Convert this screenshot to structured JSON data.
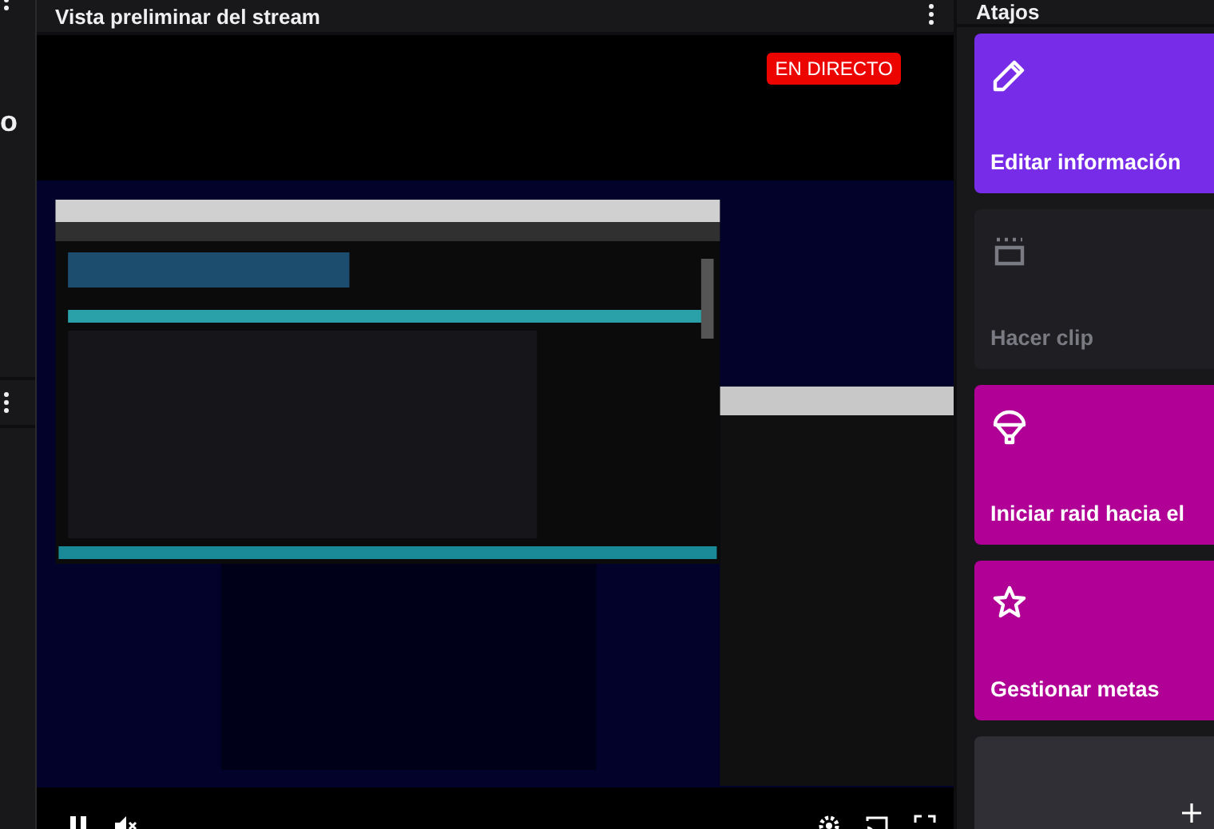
{
  "left_panel": {
    "text": "o"
  },
  "preview": {
    "title": "Vista preliminar del stream",
    "badge": "EN DIRECTO",
    "paused": false,
    "muted": true
  },
  "shortcuts": {
    "title": "Atajos",
    "items": [
      {
        "kind": "edit",
        "label": "Editar información",
        "color": "#772ce8",
        "disabled": false
      },
      {
        "kind": "clip",
        "label": "Hacer clip",
        "color": "#1f1f23",
        "disabled": true
      },
      {
        "kind": "raid",
        "label": "Iniciar raid hacia el",
        "color": "#b00095",
        "disabled": false
      },
      {
        "kind": "goals",
        "label": "Gestionar metas",
        "color": "#b00095",
        "disabled": false
      },
      {
        "kind": "add",
        "color": "#2f2f35",
        "disabled": false
      }
    ]
  }
}
